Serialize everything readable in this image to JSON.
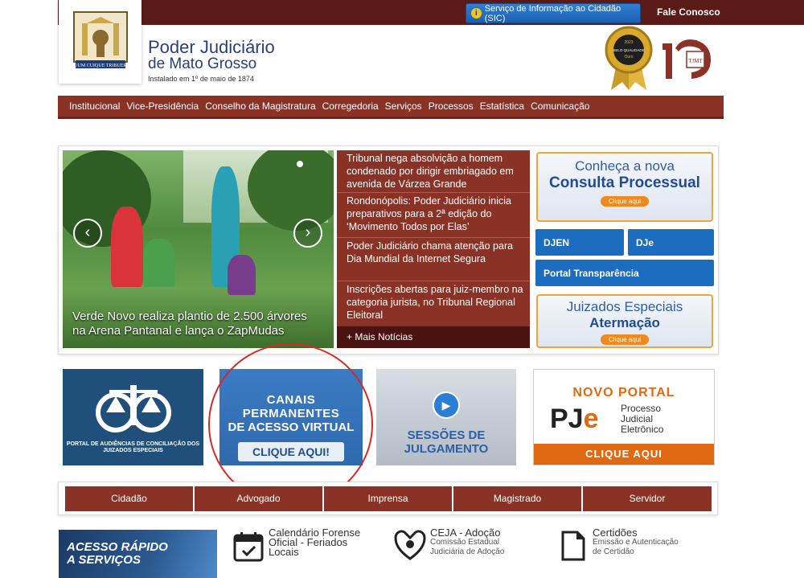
{
  "header": {
    "sic_label": "Serviço de Informação ao Cidadão (SIC)",
    "fale_label": "Fale Conosco",
    "title_line1": "Poder Judiciário",
    "title_line2": "de Mato Grosso",
    "title_line3": "Instalado em 1º de maio de 1874",
    "seal_year": "2023",
    "seal_text": "SELO QUALIDADE",
    "seal_grade": "Ouro",
    "logo150_text": "TJMT"
  },
  "menu": [
    "Institucional",
    "Vice-Presidência",
    "Conselho da Magistratura",
    "Corregedoria",
    "Serviços",
    "Processos",
    "Estatística",
    "Comunicação"
  ],
  "slider": {
    "caption_line1": "Verde Novo realiza plantio de 2.500 árvores",
    "caption_line2": "na Arena Pantanal e lança o ZapMudas",
    "prev": "‹",
    "next": "›"
  },
  "news": {
    "items": [
      "Tribunal nega absolvição a homem condenado por dirigir embriagado em avenida de Várzea Grande",
      "Rondonópolis: Poder Judiciário inicia preparativos para a 2ª edição do ‘Movimento Todos por Elas’",
      "Poder Judiciário chama atenção para Dia Mundial da Internet Segura",
      "Inscrições abertas para juiz-membro na categoria jurista, no Tribunal Regional Eleitoral"
    ],
    "more": "+ Mais Notícias"
  },
  "right": {
    "cp_line1": "Conheça a nova",
    "cp_line2": "Consulta Processual",
    "cp_btn": "Clique aqui",
    "djen": "DJEN",
    "dje": "DJe",
    "transparencia": "Portal Transparência",
    "je_line1": "Juizados Especiais",
    "je_line2": "Atermação",
    "je_btn": "Clique aqui"
  },
  "banners": {
    "b1_caption": "PORTAL DE AUDIÊNCIAS DE CONCILIAÇÃO DOS JUIZADOS ESPECIAIS",
    "b2_line1": "CANAIS PERMANENTES",
    "b2_line2": "DE ACESSO VIRTUAL",
    "b2_btn": "CLIQUE AQUI!",
    "b3_text": "SESSÕES DE JULGAMENTO",
    "b4_title": "NOVO PORTAL",
    "b4_pj": "PJ",
    "b4_e": "e",
    "b4_desc1": "Processo",
    "b4_desc2": "Judicial",
    "b4_desc3": "Eletrônico",
    "b4_btn": "CLIQUE AQUI"
  },
  "audiences": [
    "Cidadão",
    "Advogado",
    "Imprensa",
    "Magistrado",
    "Servidor"
  ],
  "quick": {
    "banner_line1": "ACESSO RÁPIDO",
    "banner_line2": "A SERVIÇOS",
    "items": [
      {
        "title": "Calendário Forense",
        "title2": "Oficial - Feriados",
        "title3": "Locais",
        "sub": ""
      },
      {
        "title": "CEJA - Adoção",
        "sub1": "Comissão Estadual",
        "sub2": "Judiciária de Adoção"
      },
      {
        "title": "Certidões",
        "sub1": "Emissão e Autenticação",
        "sub2": "de Certidão"
      }
    ]
  },
  "colors": {
    "brand": "#8b3226",
    "dark_brand": "#5a1a18",
    "accent_blue": "#1c6cc0",
    "accent_orange": "#e06a12"
  }
}
